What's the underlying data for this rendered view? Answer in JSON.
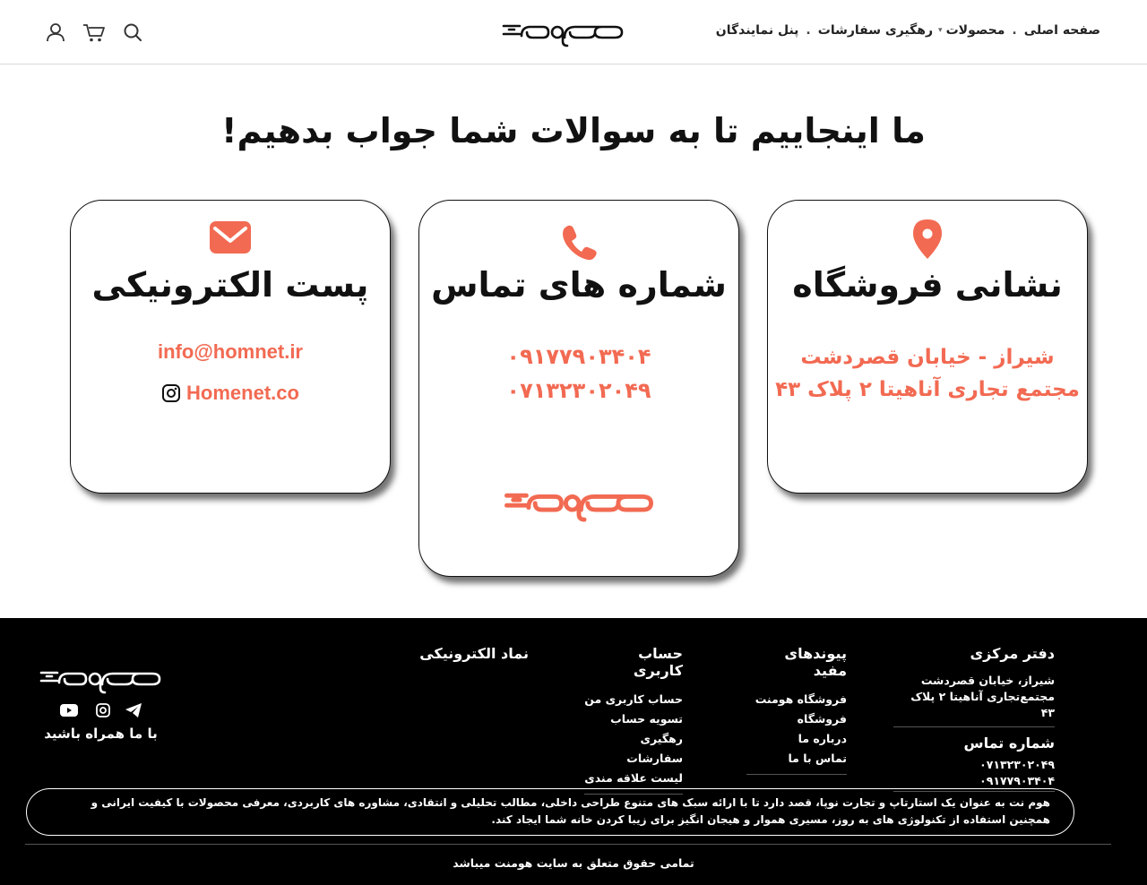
{
  "header": {
    "nav": {
      "home": "صفحه اصلی",
      "products": "محصولات",
      "tracking": "رهگیری سفارشات",
      "agents": "پنل نمایندگان"
    },
    "icons": [
      "search-icon",
      "cart-icon",
      "user-icon"
    ]
  },
  "headline": "ما اینجاییم تا به سوالات شما جواب بدهیم!",
  "cards": {
    "email": {
      "title": "پست الکترونیکی",
      "email": "info@homnet.ir",
      "instagram": "Homenet.co",
      "icon": "envelope-icon"
    },
    "phone": {
      "title": "شماره های تماس",
      "mobile": "۰۹۱۷۷۹۰۳۴۰۴",
      "landline": "۰۷۱۳۲۳۰۲۰۴۹",
      "icon": "phone-icon"
    },
    "address": {
      "title": "نشانی فروشگاه",
      "line1": "شیراز - خیابان قصردشت",
      "line2": "مجتمع تجاری آناهیتا ۲ پلاک ۴۳",
      "icon": "location-pin-icon"
    }
  },
  "footer": {
    "office": {
      "title": "دفتر مرکزی",
      "line1": "شیراز، خیابان قصردشت",
      "line2": "مجتمع‌تجاری آناهیتا ۲ پلاک ۴۳"
    },
    "contact": {
      "title": "شماره تماس",
      "landline": "۰۷۱۳۲۳۰۲۰۴۹",
      "mobile": "۰۹۱۷۷۹۰۳۴۰۴"
    },
    "links": {
      "title": "پیوندهای مفید",
      "items": [
        "فروشگاه هومنت",
        "فروشگاه",
        "درباره ما",
        "تماس با ما"
      ]
    },
    "account": {
      "title": "حساب کاربری",
      "items": [
        "حساب کاربری من",
        "تسویه حساب",
        "رهگیری سفارشات",
        "لیست علاقه مندی"
      ]
    },
    "enamad": {
      "title": "نماد الکترونیکی"
    },
    "follow": "با ما همراه باشید",
    "social": [
      "telegram-icon",
      "instagram-icon",
      "youtube-icon"
    ],
    "about": "هوم نت به عنوان یک استارتاپ و تجارت نوپا، قصد دارد تا با ارائه سبک های متنوع طراحی داخلی، مطالب تحلیلی و انتقادی، مشاوره های کاربردی، معرفی محصولات با کیفیت ایرانی و همچنین استفاده از تکنولوژی های به روز، مسیری هموار و هیجان انگیز برای زیبا کردن خانه شما ایجاد کند.",
    "copyright": "تمامی حقوق متعلق به سایت هومنت میباشد"
  },
  "colors": {
    "accent": "#f26a52",
    "footer_bg": "#000000"
  }
}
